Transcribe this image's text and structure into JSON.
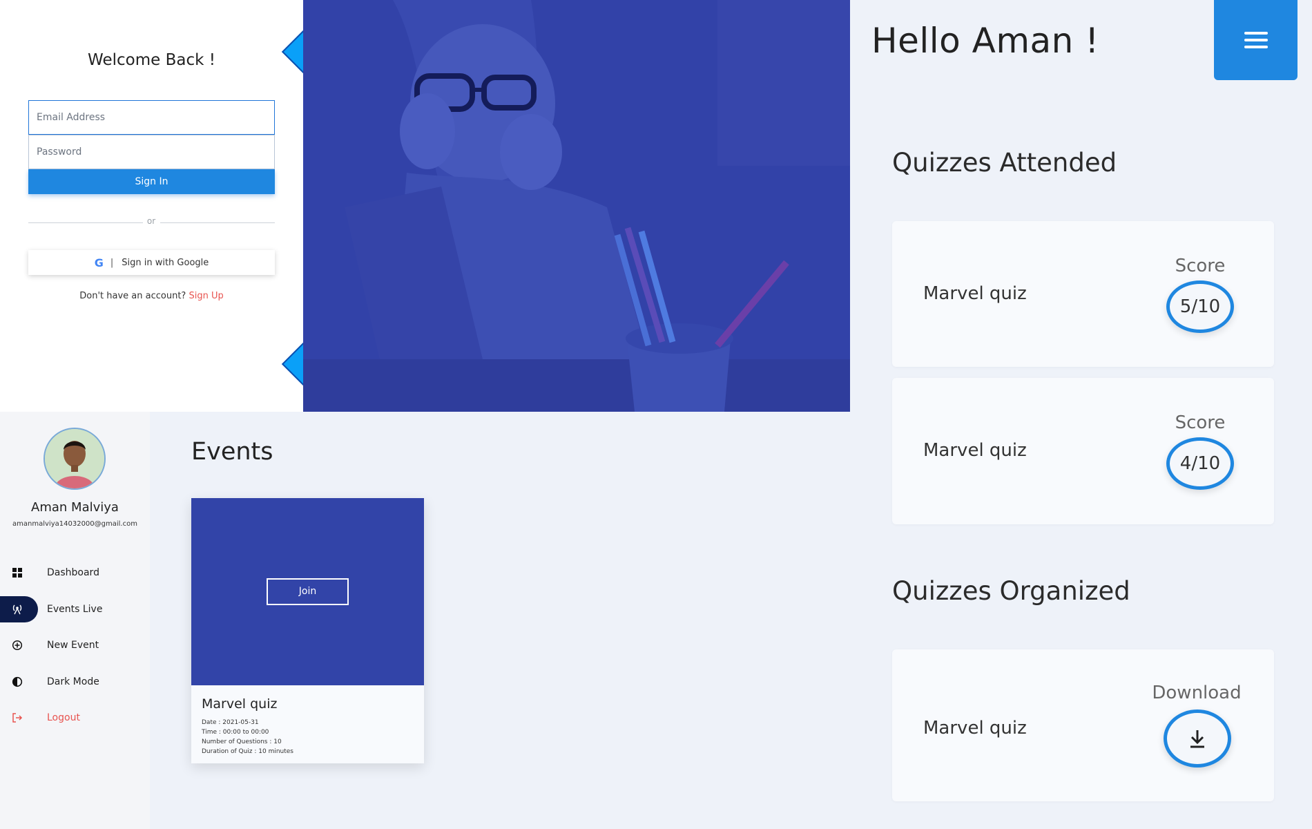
{
  "login": {
    "title": "Welcome Back !",
    "email_placeholder": "Email Address",
    "password_placeholder": "Password",
    "signin_label": "Sign In",
    "or_text": "or",
    "google_g": "G",
    "google_separator": "|",
    "google_label": "Sign in with Google",
    "no_account_text": "Don't have an account?",
    "signup_link": "Sign Up"
  },
  "dashboard": {
    "greeting": "Hello Aman !",
    "attended_title": "Quizzes Attended",
    "organized_title": "Quizzes Organized",
    "attended": [
      {
        "name": "Marvel quiz",
        "score_label": "Score",
        "score": "5/10"
      },
      {
        "name": "Marvel quiz",
        "score_label": "Score",
        "score": "4/10"
      }
    ],
    "organized": [
      {
        "name": "Marvel quiz",
        "action_label": "Download"
      }
    ]
  },
  "sidebar": {
    "name": "Aman Malviya",
    "email": "amanmalviya14032000@gmail.com",
    "items": [
      {
        "label": "Dashboard",
        "icon": "grid-icon"
      },
      {
        "label": "Events Live",
        "icon": "broadcast-icon",
        "active": true
      },
      {
        "label": "New Event",
        "icon": "plus-circle-icon"
      },
      {
        "label": "Dark Mode",
        "icon": "half-circle-icon"
      },
      {
        "label": "Logout",
        "icon": "logout-icon"
      }
    ]
  },
  "events": {
    "title": "Events",
    "cards": [
      {
        "join_label": "Join",
        "name": "Marvel quiz",
        "date": "Date : 2021-05-31",
        "time": "Time : 00:00 to 00:00",
        "questions": "Number of Questions : 10",
        "duration": "Duration of Quiz : 10 minutes"
      }
    ]
  },
  "colors": {
    "primary": "#1f87e0",
    "hero_blue": "#3242a8",
    "diamond": "#0aa0f8",
    "link_red": "#e8534f",
    "active_nav": "#0d1c4a",
    "panel_bg": "#eef2f9"
  }
}
